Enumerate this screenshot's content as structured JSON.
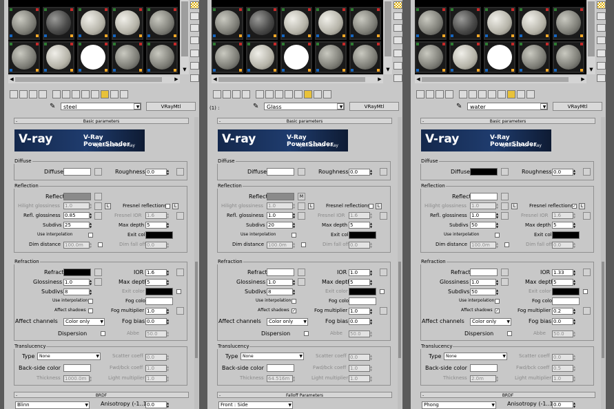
{
  "common": {
    "type_button": "VRayMtl",
    "basic_header": "Basic parameters",
    "rollout_minus": "-",
    "banner": {
      "logo": "V-ray",
      "title": "V-Ray PowerShader",
      "subtitle": "optimized for V-Ray"
    },
    "groups": {
      "diffuse": "Diffuse",
      "reflection": "Reflection",
      "refraction": "Refraction",
      "translucency": "Translucency"
    },
    "labels": {
      "diffuse": "Diffuse",
      "roughness": "Roughness",
      "reflect": "Reflect",
      "hilight": "Hilight glossiness",
      "fresnel": "Fresnel reflections",
      "refl_gloss": "Refl. glossiness",
      "fresnel_ior": "Fresnel IOR",
      "subdivs": "Subdivs",
      "max_depth": "Max depth",
      "use_interp": "Use interpolation",
      "exit_color": "Exit color",
      "dim_distance": "Dim distance",
      "dim_falloff": "Dim fall off",
      "refract": "Refract",
      "ior": "IOR",
      "glossiness": "Glossiness",
      "affect_shadows": "Affect shadows",
      "fog_color": "Fog color",
      "fog_mult": "Fog multiplier",
      "affect_channels": "Affect channels",
      "fog_bias": "Fog bias",
      "dispersion": "Dispersion",
      "abbe": "Abbe",
      "type": "Type",
      "scatter": "Scatter coeff",
      "back_side": "Back-side color",
      "fwd_bck": "Fwd/bck coeff",
      "thickness": "Thickness",
      "light_mult": "Light multiplier",
      "brdf": "BRDF",
      "anisotropy": "Anisotropy (-1..1)",
      "L": "L",
      "M": "M"
    },
    "icons": [
      "pick-material-icon",
      "put-to-scene-icon",
      "assign-icon",
      "reset-icon",
      "make-copy-icon",
      "unique-icon",
      "put-library-icon",
      "material-id-icon",
      "show-map-icon",
      "show-end-icon",
      "go-parent-icon",
      "go-sibling-icon"
    ],
    "colors": {
      "white": "#ffffff",
      "black": "#000000",
      "grey": "#8a8a8a",
      "panel": "#c8c8c8"
    }
  },
  "panels": [
    {
      "name": "steel",
      "prefix": "",
      "swatches": {
        "diffuse": "#ffffff",
        "reflect": "#8a8a8a",
        "exit": "#000000",
        "refract": "#000000",
        "fog": "#ffffff",
        "back": "#ffffff"
      },
      "values": {
        "roughness": "0.0",
        "hilight": "1.0",
        "refl_gloss": "0.85",
        "fresnel_ior": "1.6",
        "subdivs": "25",
        "max_depth": "5",
        "dim_distance": "100.0m",
        "dim_falloff": "0.0",
        "ior": "1.6",
        "glossiness": "1.0",
        "max_depth_r": "5",
        "subdivs_r": "8",
        "fog_mult": "1.0",
        "fog_bias": "0.0",
        "affect_channels": "Color only",
        "abbe": "50.0",
        "type": "None",
        "scatter": "0.0",
        "fwd_bck": "1.0",
        "thickness": "1000.0m",
        "light_mult": "1.0",
        "anisotropy": "0.0"
      },
      "checks": {
        "fresnel": "",
        "affect_shadows": "",
        "use_interp": ""
      },
      "footer": {
        "header": "BRDF",
        "dropdown": "Blinn"
      }
    },
    {
      "name": "Glass",
      "prefix": "(1) :",
      "swatches": {
        "diffuse": "#ffffff",
        "reflect": "#8a8a8a",
        "exit": "#000000",
        "refract": "#ffffff",
        "fog": "#ffffff",
        "back": "#ffffff"
      },
      "values": {
        "roughness": "0.0",
        "hilight": "1.0",
        "refl_gloss": "1.0",
        "fresnel_ior": "1.6",
        "subdivs": "20",
        "max_depth": "5",
        "dim_distance": "100.0m",
        "dim_falloff": "0.0",
        "ior": "1.0",
        "glossiness": "1.0",
        "max_depth_r": "5",
        "subdivs_r": "8",
        "fog_mult": "1.0",
        "fog_bias": "0.0",
        "affect_channels": "Color only",
        "abbe": "50.0",
        "type": "None",
        "scatter": "0.0",
        "fwd_bck": "1.0",
        "thickness": "64.516m",
        "light_mult": "1.0",
        "anisotropy": ""
      },
      "checks": {
        "fresnel": "",
        "affect_shadows": "✓",
        "use_interp": ""
      },
      "footer": {
        "header": "Falloff Parameters",
        "dropdown": "Front : Side"
      }
    },
    {
      "name": "water",
      "prefix": "",
      "swatches": {
        "diffuse": "#000000",
        "reflect": "#ffffff",
        "exit": "#000000",
        "refract": "#ffffff",
        "fog": "#ffffff",
        "back": "#ffffff"
      },
      "values": {
        "roughness": "0.0",
        "hilight": "1.0",
        "refl_gloss": "1.0",
        "fresnel_ior": "1.6",
        "subdivs": "50",
        "max_depth": "5",
        "dim_distance": "100.0m",
        "dim_falloff": "0.0",
        "ior": "1.33",
        "glossiness": "1.0",
        "max_depth_r": "5",
        "subdivs_r": "50",
        "fog_mult": "0.2",
        "fog_bias": "0.0",
        "affect_channels": "Color only",
        "abbe": "50.0",
        "type": "None",
        "scatter": "0.0",
        "fwd_bck": "0.5",
        "thickness": "2.0m",
        "light_mult": "1.0",
        "anisotropy": "0.0"
      },
      "checks": {
        "fresnel": "✓",
        "affect_shadows": "✓",
        "use_interp": ""
      },
      "footer": {
        "header": "BRDF",
        "dropdown": "Phong"
      }
    }
  ],
  "slot_spheres": [
    "grey",
    "dark",
    "light",
    "light",
    "grey",
    "grey",
    "light",
    "white",
    "grey",
    "grey"
  ]
}
